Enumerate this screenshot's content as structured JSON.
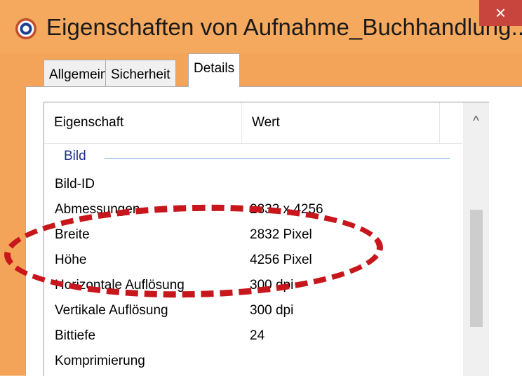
{
  "window": {
    "title": "Eigenschaften von Aufnahme_Buchhandlung...",
    "close_label": "×"
  },
  "tabs": [
    {
      "label": "Allgemein",
      "active": false
    },
    {
      "label": "Sicherheit",
      "active": false
    },
    {
      "label": "Details",
      "active": true
    }
  ],
  "table": {
    "columns": [
      "Eigenschaft",
      "Wert"
    ],
    "group": "Bild",
    "rows": [
      {
        "name": "Bild-ID",
        "value": ""
      },
      {
        "name": "Abmessungen",
        "value": "2832 x 4256"
      },
      {
        "name": "Breite",
        "value": "2832 Pixel"
      },
      {
        "name": "Höhe",
        "value": "4256 Pixel"
      },
      {
        "name": "Horizontale Auflösung",
        "value": "300 dpi"
      },
      {
        "name": "Vertikale Auflösung",
        "value": "300 dpi"
      },
      {
        "name": "Bittiefe",
        "value": "24"
      },
      {
        "name": "Komprimierung",
        "value": ""
      }
    ]
  },
  "scrollbar": {
    "up_glyph": "^"
  },
  "colors": {
    "title_bar": "#f4a95e",
    "close_button": "#c7453c",
    "group_header": "#1e3287",
    "annotation": "#c8171c"
  }
}
